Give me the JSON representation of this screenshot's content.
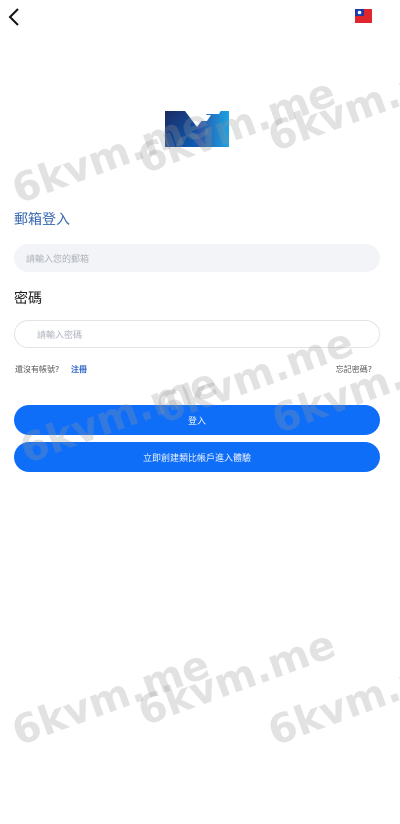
{
  "email_login_title": "郵箱登入",
  "email_input_placeholder": "請輸入您的郵箱",
  "password_label": "密碼",
  "password_input_placeholder": "請輸入密碼",
  "no_account_text": "還沒有帳號?",
  "register_link": "注冊",
  "forgot_password_link": "忘記密碼?",
  "login_button": "登入",
  "demo_button": "立即創建類比帳戶進入體驗",
  "watermark_text": "6kvm.me",
  "colors": {
    "accent": "#0f6ef8",
    "title": "#3767b1"
  }
}
